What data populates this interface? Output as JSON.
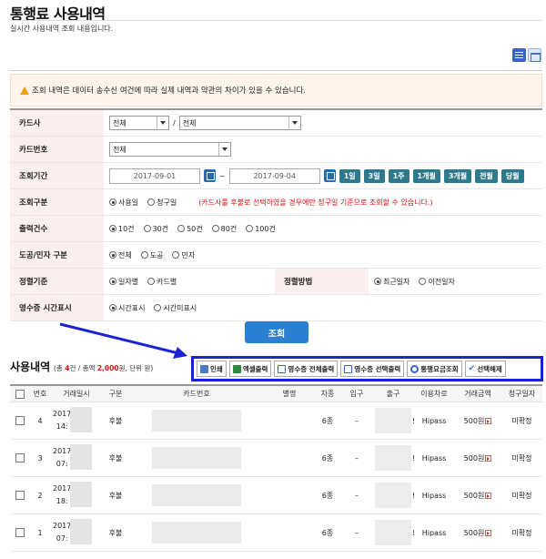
{
  "page": {
    "title": "통행료 사용내역",
    "subtitle": "실시간 사용내역 조회 내용입니다."
  },
  "notice": "조회 내역은 데이터 송수신 여건에 따라 실제 내역과 약관의 차이가 있을 수 있습니다.",
  "form": {
    "card_company": {
      "label": "카드사",
      "select1": "전체",
      "separator": "/",
      "select2": "전체"
    },
    "card_number": {
      "label": "카드번호",
      "select": "전체"
    },
    "period": {
      "label": "조회기간",
      "start": "2017-09-01",
      "tilde": "~",
      "end": "2017-09-04",
      "presets": [
        "1일",
        "3일",
        "1주",
        "1개월",
        "3개월",
        "전월",
        "당월"
      ]
    },
    "query_type": {
      "label": "조회구분",
      "options": [
        "사용일",
        "청구일"
      ],
      "selected": "사용일",
      "note": "(카드사를 후불로 선택하였을 경우에만 청구일 기준으로 조회할 수 있습니다.)"
    },
    "output_count": {
      "label": "출력건수",
      "options": [
        "10건",
        "30건",
        "50건",
        "80건",
        "100건"
      ],
      "selected": "10건"
    },
    "road_type": {
      "label": "도공/민자 구분",
      "options": [
        "전체",
        "도공",
        "민자"
      ],
      "selected": "전체"
    },
    "sort_key": {
      "label": "정렬기준",
      "options": [
        "일자별",
        "카드별"
      ],
      "selected": "일자별"
    },
    "sort_order": {
      "label": "정렬방법",
      "options": [
        "최근일자",
        "이전일자"
      ],
      "selected": "최근일자"
    },
    "receipt_time": {
      "label": "영수증 시간표시",
      "options": [
        "시간표시",
        "시간미표시"
      ],
      "selected": "시간표시"
    }
  },
  "search_button": "조회",
  "usage": {
    "title": "사용내역",
    "summary_prefix": "(총 ",
    "count": "4",
    "count_suffix": "건 / 총액 ",
    "total": "2,000",
    "summary_suffix": "원, 단위 원)"
  },
  "toolbar": [
    "인쇄",
    "엑셀출력",
    "영수증 전체출력",
    "영수증 선택출력",
    "통행요금조회",
    "선택해제"
  ],
  "table": {
    "headers": [
      "번호",
      "거래일시",
      "구분",
      "카드번호",
      "별명",
      "차종",
      "입구",
      "출구",
      "이용차로",
      "거래금액",
      "청구일자"
    ],
    "rows": [
      {
        "no": "4",
        "dt1": "2017",
        "dt2": "14:",
        "type": "후불",
        "class": "6종",
        "entry": "–",
        "out_mark": "!",
        "lane": "Hipass",
        "amount": "500원",
        "bill": "미확정"
      },
      {
        "no": "3",
        "dt1": "2017",
        "dt2": "07:",
        "type": "후불",
        "class": "6종",
        "entry": "–",
        "out_mark": "!",
        "lane": "Hipass",
        "amount": "500원",
        "bill": "미확정"
      },
      {
        "no": "2",
        "dt1": "2017",
        "dt2": "18:",
        "type": "후불",
        "class": "6종",
        "entry": "–",
        "out_mark": "!",
        "lane": "Hipass",
        "amount": "500원",
        "bill": "미확정"
      },
      {
        "no": "1",
        "dt1": "2017",
        "dt2": "07:",
        "type": "후불",
        "class": "6종",
        "entry": "–",
        "out_mark": "!",
        "lane": "Hipass",
        "amount": "500원",
        "bill": "미확정"
      }
    ]
  },
  "colors": {
    "accent_blue": "#2b7fd0",
    "preset_teal": "#2d7a8c",
    "highlight_border": "#1a22d8",
    "label_bg": "#fbefef",
    "red": "#d11111"
  }
}
